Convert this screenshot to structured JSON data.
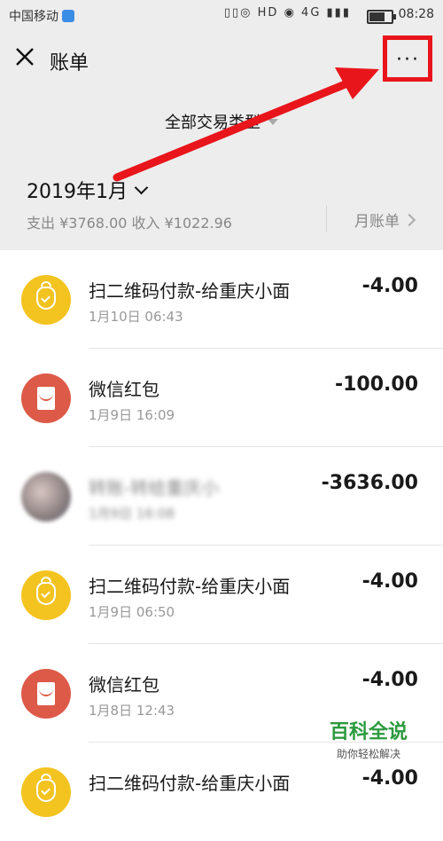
{
  "status": {
    "carrier": "中国移动",
    "icons": "▯▯◎ HD ◉ 4G ▮▮▮",
    "time": "08:28"
  },
  "nav": {
    "title": "账单",
    "more": "···"
  },
  "filter": {
    "label": "全部交易类型"
  },
  "month": {
    "label": "2019年1月",
    "summary": "支出 ¥3768.00 收入 ¥1022.96",
    "monthly_bill": "月账单"
  },
  "transactions": [
    {
      "icon": "money-bag-icon",
      "name": "扫二维码付款-给重庆小面",
      "date": "1月10日 06:43",
      "amount": "-4.00"
    },
    {
      "icon": "red-packet-icon",
      "name": "微信红包",
      "date": "1月9日 16:09",
      "amount": "-100.00"
    },
    {
      "icon": "avatar",
      "name": "转账-转给重庆小",
      "date": "1月9日 16:08",
      "amount": "-3636.00"
    },
    {
      "icon": "money-bag-icon",
      "name": "扫二维码付款-给重庆小面",
      "date": "1月9日 06:50",
      "amount": "-4.00"
    },
    {
      "icon": "red-packet-icon",
      "name": "微信红包",
      "date": "1月8日 12:43",
      "amount": "-4.00"
    },
    {
      "icon": "money-bag-icon",
      "name": "扫二维码付款-给重庆小面",
      "date": "",
      "amount": "-4.00"
    }
  ],
  "watermark": {
    "title": "百科全说",
    "subtitle": "助你轻松解决"
  },
  "colors": {
    "background": "#ededed",
    "highlight": "#e8151b",
    "yellow": "#f3c320",
    "red": "#dd5a48"
  }
}
